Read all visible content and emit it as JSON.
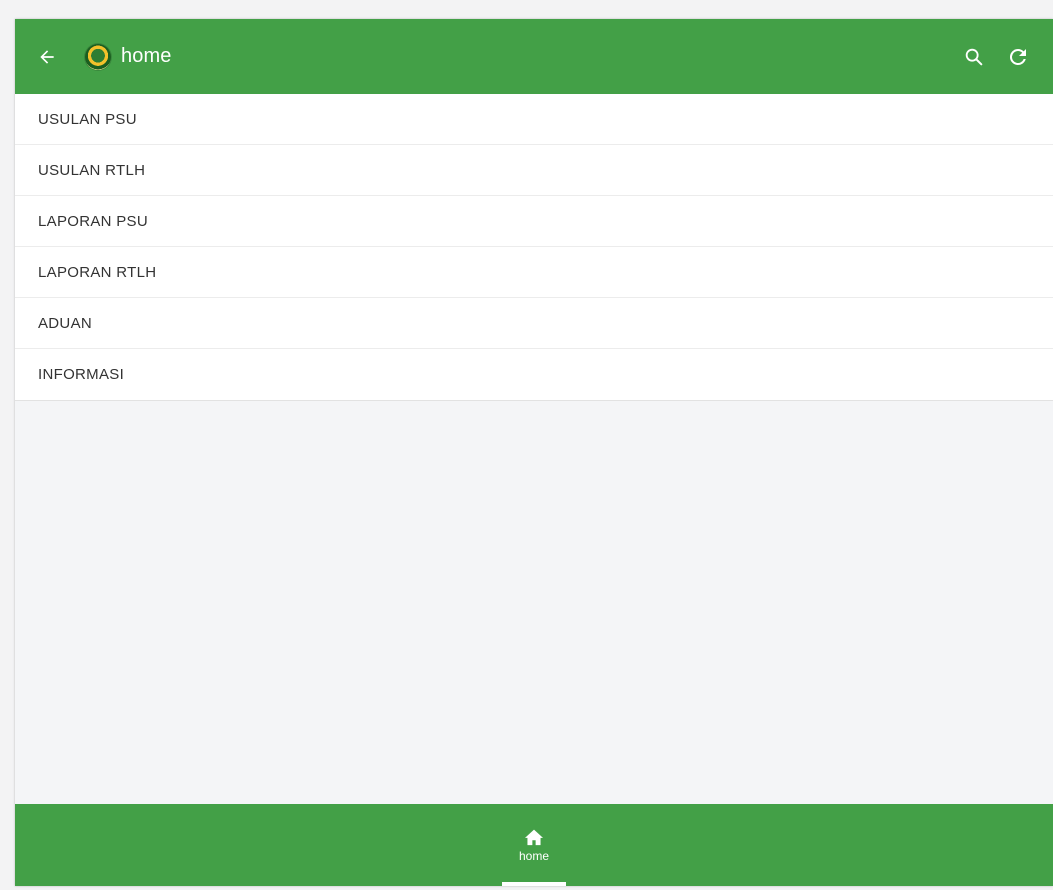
{
  "appbar": {
    "title": "home",
    "back_icon": "arrow-left-icon",
    "logo": "app-logo",
    "actions": [
      "search-icon",
      "refresh-icon"
    ],
    "color": "#43a047"
  },
  "menu": {
    "items": [
      {
        "label": "USULAN PSU"
      },
      {
        "label": "USULAN RTLH"
      },
      {
        "label": "LAPORAN PSU"
      },
      {
        "label": "LAPORAN RTLH"
      },
      {
        "label": "ADUAN"
      },
      {
        "label": "INFORMASI"
      }
    ]
  },
  "bottom_nav": {
    "tabs": [
      {
        "label": "home",
        "icon": "home-icon",
        "active": true
      }
    ]
  }
}
